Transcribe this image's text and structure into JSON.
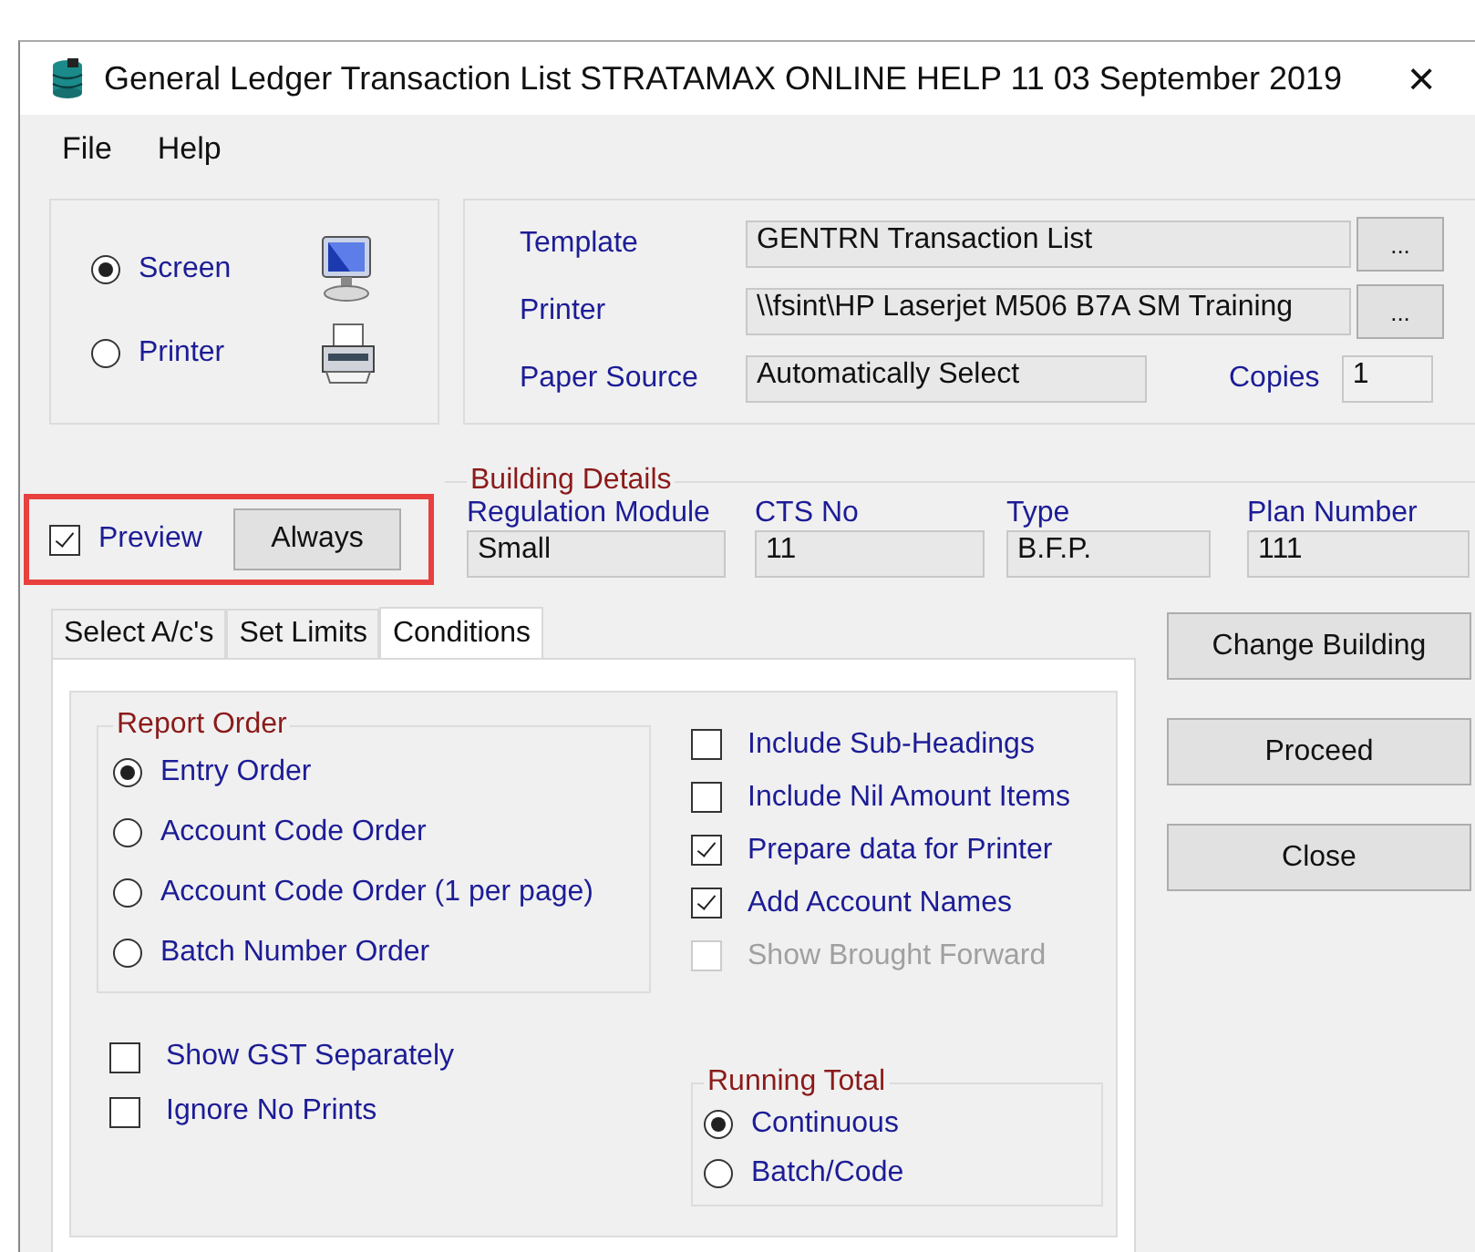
{
  "window": {
    "title": "General Ledger Transaction List STRATAMAX ONLINE HELP 11 03 September 2019",
    "close": "×"
  },
  "menu": [
    "File",
    "Help"
  ],
  "output": [
    {
      "kind": "screen",
      "label": "Screen",
      "selected": true
    },
    {
      "kind": "printer",
      "label": "Printer",
      "selected": false
    }
  ],
  "settings": {
    "template_label": "Template",
    "template": "GENTRN Transaction List",
    "template_button": "...",
    "printer_label": "Printer",
    "printer": "\\\\fsint\\HP Laserjet M506 B7A SM Training",
    "printer_button": "...",
    "paper_source_label": "Paper Source",
    "paper_source": "Automatically Select",
    "copies_label": "Copies",
    "copies": "1"
  },
  "preview": {
    "label": "Preview",
    "checked": true,
    "button": "Always",
    "highlighted": true
  },
  "building_details": {
    "title": "Building Details",
    "fields": [
      {
        "label": "Regulation Module",
        "value": "Small"
      },
      {
        "label": "CTS No",
        "value": "11"
      },
      {
        "label": "Type",
        "value": "B.F.P."
      },
      {
        "label": "Plan Number",
        "value": "111"
      }
    ]
  },
  "tabs": [
    {
      "label": "Select A/c's",
      "selected": false
    },
    {
      "label": "Set Limits",
      "selected": false
    },
    {
      "label": "Conditions",
      "selected": true
    }
  ],
  "report_order": {
    "title": "Report Order",
    "options": [
      {
        "label": "Entry Order",
        "selected": true
      },
      {
        "label": "Account Code Order",
        "selected": false
      },
      {
        "label": "Account Code Order (1 per page)",
        "selected": false
      },
      {
        "label": "Batch Number Order",
        "selected": false
      }
    ]
  },
  "options": [
    {
      "label": "Include Sub-Headings",
      "checked": false,
      "disabled": false
    },
    {
      "label": "Include Nil Amount Items",
      "checked": false,
      "disabled": false
    },
    {
      "label": "Prepare data for Printer",
      "checked": true,
      "disabled": false
    },
    {
      "label": "Add Account Names",
      "checked": true,
      "disabled": false
    },
    {
      "label": "Show Brought Forward",
      "checked": false,
      "disabled": true
    }
  ],
  "extra_options": [
    {
      "label": "Show GST Separately",
      "checked": false
    },
    {
      "label": "Ignore No Prints",
      "checked": false
    }
  ],
  "running_total": {
    "title": "Running Total",
    "options": [
      {
        "label": "Continuous",
        "selected": true
      },
      {
        "label": "Batch/Code",
        "selected": false
      }
    ]
  },
  "buttons": [
    "Change Building",
    "Proceed",
    "Close"
  ]
}
